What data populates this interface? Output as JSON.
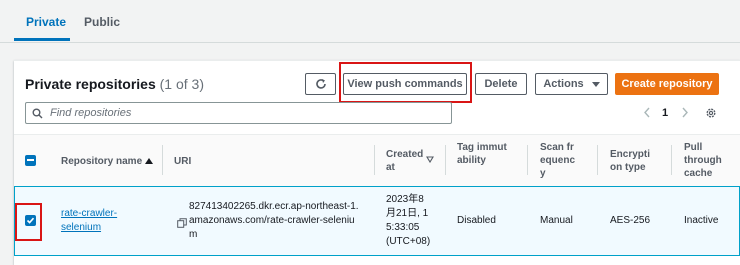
{
  "tabs": [
    {
      "label": "Private",
      "active": true
    },
    {
      "label": "Public",
      "active": false
    }
  ],
  "header": {
    "title": "Private repositories",
    "count": "(1 of 3)"
  },
  "toolbar": {
    "refresh_icon": "refresh-icon",
    "view_push_label": "View push commands",
    "delete_label": "Delete",
    "actions_label": "Actions",
    "create_label": "Create repository"
  },
  "search": {
    "placeholder": "Find repositories",
    "value": ""
  },
  "pagination": {
    "current_page": "1"
  },
  "table": {
    "columns": [
      {
        "label": "Repository name",
        "sort": "ascending"
      },
      {
        "label": "URI"
      },
      {
        "label": "Created at",
        "sort": "descending"
      },
      {
        "label": "Tag immutability"
      },
      {
        "label": "Scan frequency"
      },
      {
        "label": "Encryption type"
      },
      {
        "label": "Pull through cache"
      }
    ],
    "rows": [
      {
        "selected": true,
        "name": "rate-crawler-selenium",
        "uri": "827413402265.dkr.ecr.ap-northeast-1.amazonaws.com/rate-crawler-selenium",
        "created_at": "2023年8月21日, 15:33:05 (UTC+08)",
        "tag_immutability": "Disabled",
        "scan_frequency": "Manual",
        "encryption_type": "AES-256",
        "pull_through_cache": "Inactive"
      }
    ]
  },
  "colors": {
    "accent": "#0073bb",
    "primary_button": "#ec7211",
    "highlight": "#d91515"
  }
}
